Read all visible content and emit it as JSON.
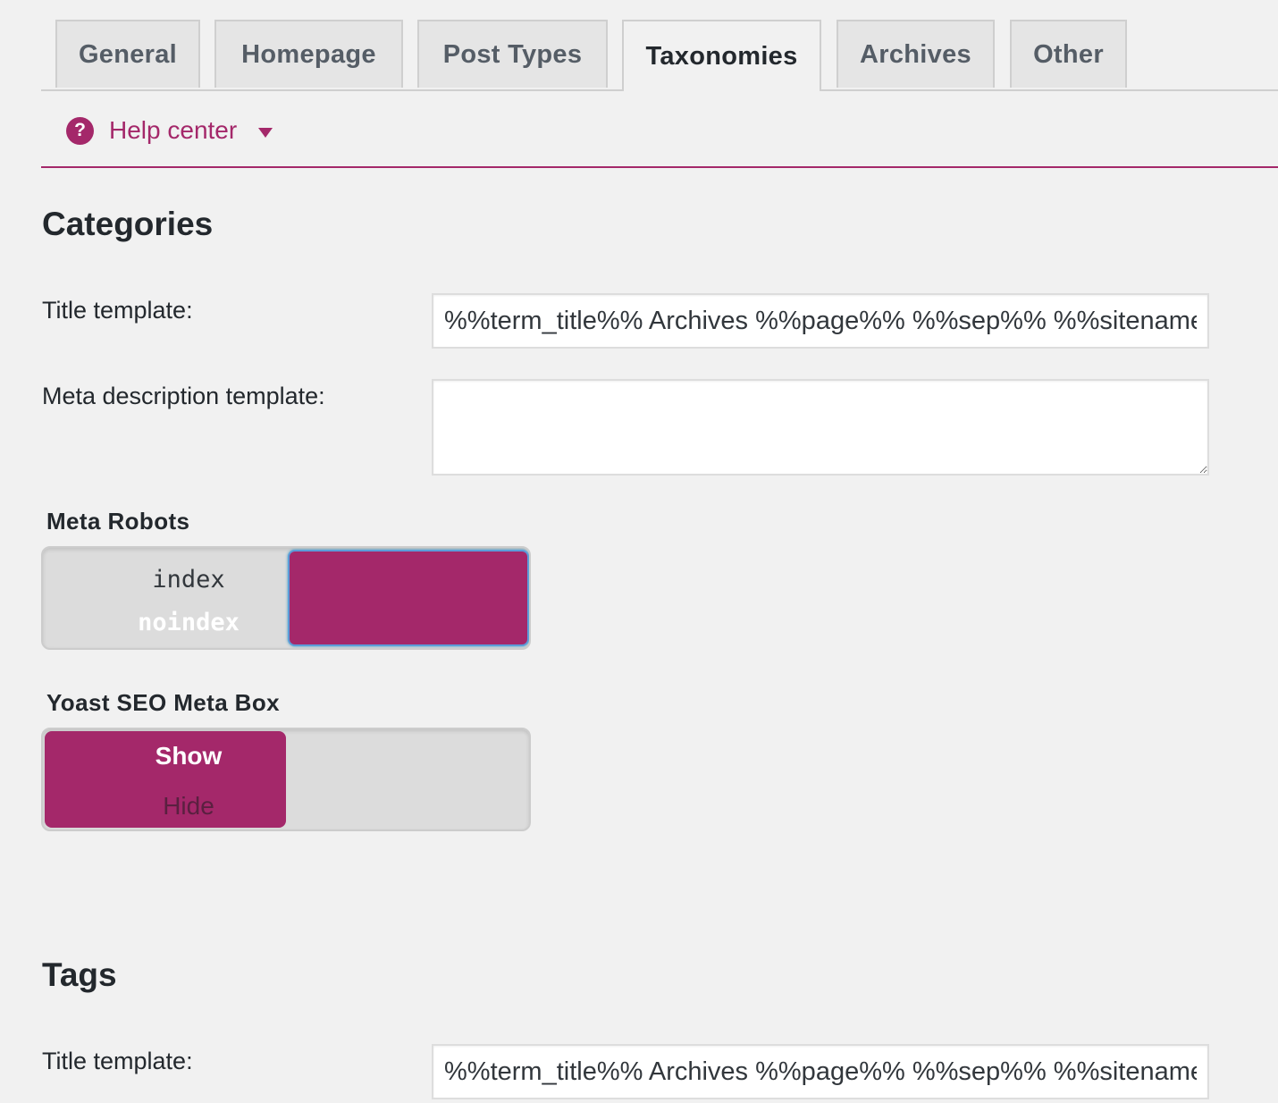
{
  "tabs": [
    {
      "label": "General",
      "active": false
    },
    {
      "label": "Homepage",
      "active": false
    },
    {
      "label": "Post Types",
      "active": false
    },
    {
      "label": "Taxonomies",
      "active": true
    },
    {
      "label": "Archives",
      "active": false
    },
    {
      "label": "Other",
      "active": false
    }
  ],
  "help": {
    "icon": "question-circle-icon",
    "label": "Help center",
    "caret": "caret-down-icon"
  },
  "colors": {
    "accent": "#a4286a",
    "background": "#f1f1f1"
  },
  "categories": {
    "title": "Categories",
    "title_template_label": "Title template:",
    "title_template_value": "%%term_title%% Archives %%page%% %%sep%% %%sitename%%",
    "meta_desc_label": "Meta description template:",
    "meta_desc_value": "",
    "meta_robots": {
      "label": "Meta Robots",
      "options": [
        "index",
        "noindex"
      ],
      "selected": "noindex"
    },
    "meta_box": {
      "label": "Yoast SEO Meta Box",
      "options": [
        "Show",
        "Hide"
      ],
      "selected": "Show"
    }
  },
  "tags": {
    "title": "Tags",
    "title_template_label": "Title template:",
    "title_template_value": "%%term_title%% Archives %%page%% %%sep%% %%sitename%%"
  }
}
